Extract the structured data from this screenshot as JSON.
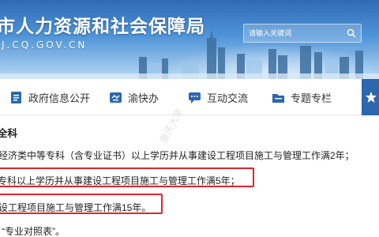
{
  "header": {
    "site_title": "市人力资源和社会保障局",
    "site_url": "J.CQ.GOV.CN",
    "search_placeholder": "请输入关键词"
  },
  "nav": {
    "items": [
      {
        "label": "政府信息公开",
        "icon": "document-icon"
      },
      {
        "label": "渝快办",
        "icon": "handshake-icon"
      },
      {
        "label": "互动交流",
        "icon": "chat-icon"
      },
      {
        "label": "专题专栏",
        "icon": "folder-icon"
      }
    ],
    "extra_icon": "star-icon"
  },
  "content": {
    "heading": "全科",
    "line1": "经济类中等专科（含专业证书）以上学历并从事建设工程项目施工与管理工作满2年；",
    "line2": "专科以上学历并从事建设工程项目施工与管理工作满5年；",
    "line3": "设工程项目施工与管理工作满15年。",
    "line4": "“专业对照表”。",
    "watermark": "重庆大学"
  },
  "colors": {
    "banner_blue": "#3a7cc6",
    "accent_blue": "#2c67b0",
    "highlight_red": "#e0262b"
  }
}
